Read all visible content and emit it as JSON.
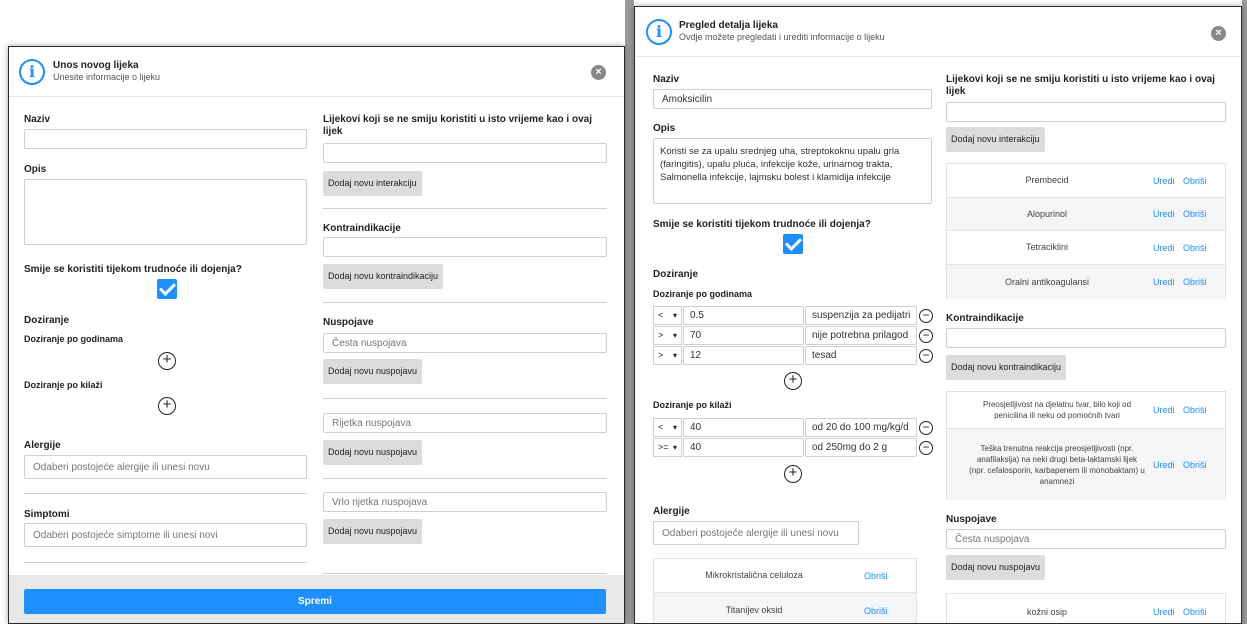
{
  "left": {
    "header": {
      "title": "Unos novog lijeka",
      "subtitle": "Unesite informacije o lijeku"
    },
    "naziv_label": "Naziv",
    "opis_label": "Opis",
    "trudnoca_label": "Smije se koristiti tijekom trudnoće ili dojenja?",
    "doziranje_label": "Doziranje",
    "dob_label": "Doziranje po godinama",
    "kilaza_label": "Doziranje po kilaži",
    "alergije_label": "Alergije",
    "alergije_placeholder": "Odaberi postojeće alergije ili unesi novu",
    "simptomi_label": "Simptomi",
    "simptomi_placeholder": "Odaberi postojeće simptome ili unesi novi",
    "interakcije_label": "Lijekovi koji se ne smiju koristiti u isto vrijeme kao i ovaj lijek",
    "dodaj_interakciju": "Dodaj novu interakciju",
    "kontraindikacije_label": "Kontraindikacije",
    "dodaj_kontraindikaciju": "Dodaj novu kontraindikaciju",
    "nuspojave_label": "Nuspojave",
    "cesta_placeholder": "Česta nuspojava",
    "rijetka_placeholder": "Rijetka nuspojava",
    "vrlo_rijetka_placeholder": "Vrlo rijetka nuspojava",
    "dodaj_nuspojavu": "Dodaj novu nuspojavu",
    "spremi": "Spremi"
  },
  "right": {
    "header": {
      "title": "Pregled detalja lijeka",
      "subtitle": "Ovdje možete pregledati i urediti informacije o lijeku"
    },
    "naziv_label": "Naziv",
    "naziv_value": "Amoksicilin",
    "opis_label": "Opis",
    "opis_value": "Koristi se za upalu srednjeg uha, streptokoknu upalu grla (faringitis), upalu pluća, infekcije kože, urinarnog trakta, Salmonella infekcije, lajmsku bolest i klamidija infekcije",
    "trudnoca_label": "Smije se koristiti tijekom trudnoće ili dojenja?",
    "doziranje_label": "Doziranje",
    "dob_label": "Doziranje po godinama",
    "dob_rows": [
      {
        "op": "<",
        "value": "0.5",
        "text": "suspenzija za pedijatri"
      },
      {
        "op": ">",
        "value": "70",
        "text": "nije potrebna prilagod"
      },
      {
        "op": ">",
        "value": "12",
        "text": "tesad"
      }
    ],
    "kilaza_label": "Doziranje po kilaži",
    "kilaza_rows": [
      {
        "op": "<",
        "value": "40",
        "text": "od 20 do 100 mg/kg/d"
      },
      {
        "op": ">=",
        "value": "40",
        "text": "od 250mg do 2 g"
      }
    ],
    "alergije_label": "Alergije",
    "alergije_placeholder": "Odaberi postojeće alergije ili unesi novu",
    "alergije_rows": [
      "Mikrokristalična celuloza",
      "Titanijev oksid"
    ],
    "interakcije_label": "Lijekovi koji se ne smiju koristiti u isto vrijeme kao i ovaj lijek",
    "dodaj_interakciju": "Dodaj novu interakciju",
    "interakcije_rows": [
      "Prembecid",
      "Alopurinol",
      "Tetraciklini",
      "Oralni antikoagulansi"
    ],
    "kontraindikacije_label": "Kontraindikacije",
    "dodaj_kontraindikaciju": "Dodaj novu kontraindikaciju",
    "kontra_rows": [
      "Preosjetljivost na djelatnu tvar, bilo koji od penicilina ili neku od pomoćnih tvari",
      "Teška trenutna reakcija preosjetljivosti (npr. anafilaksija) na neki drugi beta-laktamski lijek (npr. cefalosporin, karbapenem ili monobaktam) u anamnezi"
    ],
    "nuspojave_label": "Nuspojave",
    "cesta_placeholder": "Česta nuspojava",
    "dodaj_nuspojavu": "Dodaj novu nuspojavu",
    "nuspojave_rows": [
      "kožni osip"
    ],
    "uredi": "Uredi",
    "obrisi": "Obriši"
  },
  "icons": {
    "info": "info-icon",
    "close": "close-icon",
    "add": "plus-circle-icon",
    "remove": "minus-circle-icon",
    "checkbox": "check-icon"
  },
  "colors": {
    "accent": "#1e8fff",
    "button_gray": "#dcdcdc"
  }
}
